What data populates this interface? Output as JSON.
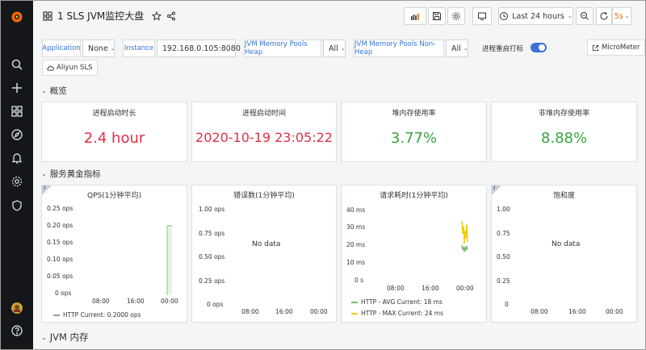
{
  "dashboard": {
    "title": "1 SLS JVM监控大盘",
    "time_range": "Last 24 hours",
    "refresh": "5s"
  },
  "variables": {
    "application": {
      "label": "Application",
      "value": "None"
    },
    "instance": {
      "label": "Instance",
      "value": "192.168.0.105:8080"
    },
    "heap": {
      "label": "JVM Memory Pools Heap",
      "value": "All"
    },
    "nonheap": {
      "label": "JVM Memory Pools Non-Heap",
      "value": "All"
    },
    "restart_toggle": {
      "label": "进程重启打标",
      "on": true
    },
    "link_micrometer": "MicroMeter",
    "link_aliyun": "Aliyun SLS"
  },
  "sections": {
    "overview": "概览",
    "golden": "服务黄金指标",
    "jvm_memory": "JVM 内存"
  },
  "stats": [
    {
      "title": "进程启动时长",
      "value": "2.4 hour",
      "color": "#e02f44"
    },
    {
      "title": "进程启动时间",
      "value": "2020-10-19 23:05:22",
      "color": "#e02f44"
    },
    {
      "title": "堆内存使用率",
      "value": "3.77%",
      "color": "#37a43e"
    },
    {
      "title": "非堆内存使用率",
      "value": "8.88%",
      "color": "#37a43e"
    }
  ],
  "graphs": {
    "qps": {
      "title": "QPS(1分钟平均)",
      "yticks": [
        "0.25 ops",
        "0.20 ops",
        "0.15 ops",
        "0.10 ops",
        "0.05 ops",
        "0 ops"
      ],
      "xticks": [
        "08:00",
        "16:00",
        "00:00"
      ],
      "legend": [
        {
          "text": "HTTP  Current: 0.2000 ops",
          "color": "#999999"
        }
      ]
    },
    "errors": {
      "title": "错误数(1分钟平均)",
      "yticks": [
        "1.00 ops",
        "0.75 ops",
        "0.50 ops",
        "0.25 ops",
        "0 ops"
      ],
      "xticks": [
        "08:00",
        "16:00",
        "00:00"
      ],
      "nodata": "No data"
    },
    "latency": {
      "title": "请求耗时(1分钟平均)",
      "yticks": [
        "40 ms",
        "30 ms",
        "20 ms",
        "10 ms",
        "0 s"
      ],
      "xticks": [
        "08:00",
        "16:00",
        "00:00"
      ],
      "legend": [
        {
          "text": "HTTP - AVG  Current: 18 ms",
          "color": "#73bf69"
        },
        {
          "text": "HTTP - MAX  Current: 24 ms",
          "color": "#f2cc0c"
        }
      ]
    },
    "saturation": {
      "title": "饱和度",
      "yticks": [
        "1.00",
        "0.75",
        "0.50",
        "0.25",
        "0"
      ],
      "xticks": [
        "08:00",
        "16:00",
        "00:00"
      ],
      "nodata": "No data"
    }
  },
  "colors": {
    "sidebar": "#141619",
    "accent": "#3274d9",
    "series_qps": "#73bf69",
    "series_avg": "#73bf69",
    "series_max": "#f2cc0c"
  },
  "icons": [
    "grafana-logo-icon",
    "search-icon",
    "plus-icon",
    "dashboards-icon",
    "explore-icon",
    "bell-icon",
    "gear-icon",
    "shield-icon",
    "avatar",
    "help-icon"
  ]
}
